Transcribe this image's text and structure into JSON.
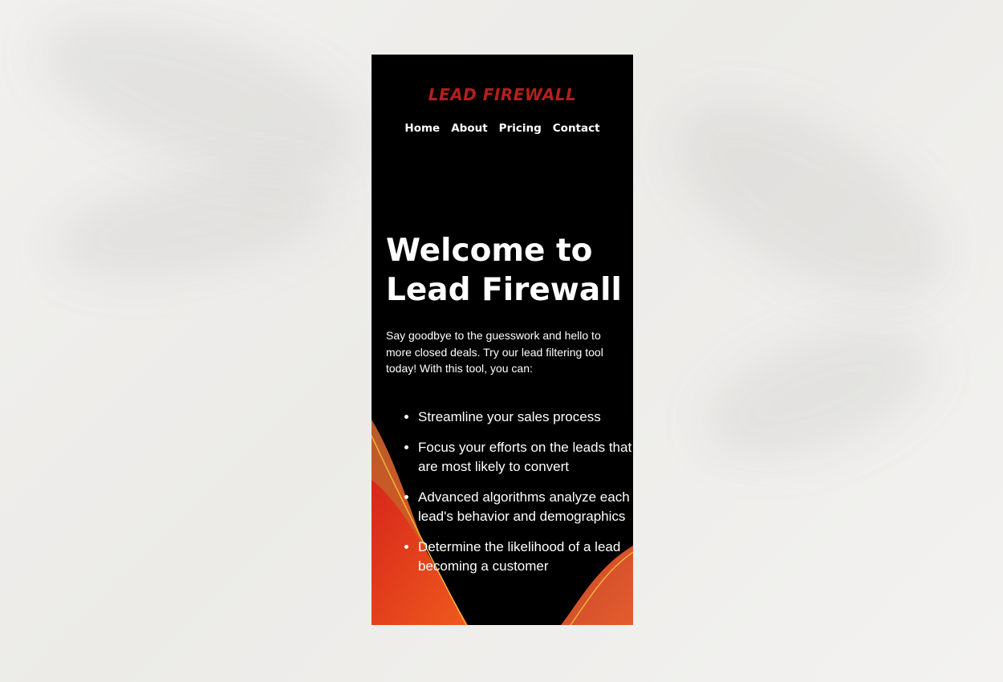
{
  "brand": {
    "logo_text": "LEAD FIREWALL",
    "accent": "#b3201c"
  },
  "nav": {
    "items": [
      "Home",
      "About",
      "Pricing",
      "Contact"
    ]
  },
  "hero": {
    "title_line1": "Welcome to",
    "title_line2": "Lead Firewall",
    "intro": "Say goodbye to the guesswork and hello to more closed deals. Try our lead filtering tool today! With this tool, you can:"
  },
  "features": [
    "Streamline your sales process",
    "Focus your efforts on the leads that are most likely to convert",
    "Advanced algorithms analyze each lead's behavior and demographics",
    "Determine the likelihood of a lead becoming a customer"
  ],
  "colors": {
    "page_bg": "#f1f0ee",
    "panel_bg": "#000000",
    "wave_orange": "#e8461f",
    "wave_red": "#c8201a",
    "wave_line": "#f3b338"
  }
}
